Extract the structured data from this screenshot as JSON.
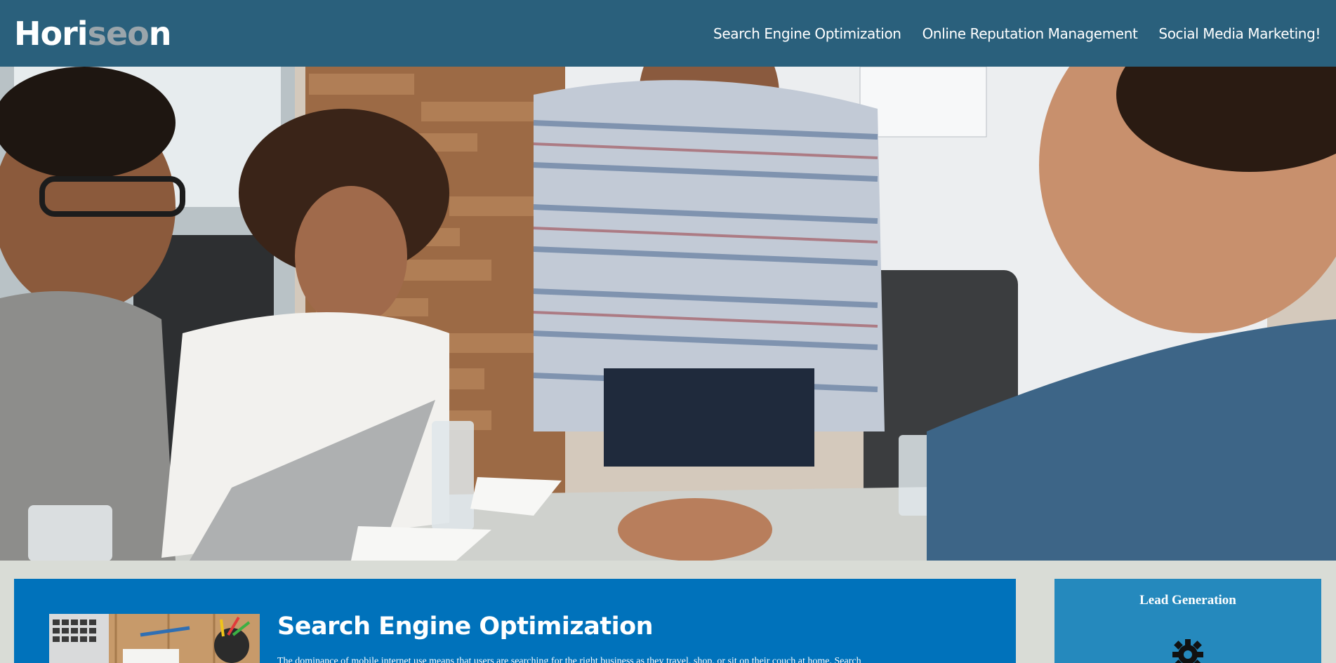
{
  "header": {
    "logo_part1": "Hori",
    "logo_part2": "seo",
    "logo_part3": "n",
    "nav": [
      {
        "label": "Search Engine Optimization"
      },
      {
        "label": "Online Reputation Management"
      },
      {
        "label": "Social Media Marketing!"
      }
    ]
  },
  "hero": {
    "image": "team-meeting-photo"
  },
  "main": {
    "section_title": "Search Engine Optimization",
    "section_text": "The dominance of mobile internet use means that users are searching for the right business as they travel, shop, or sit on their couch at home. Search",
    "section_image": "desk-workspace-image"
  },
  "sidebar": {
    "title": "Lead Generation",
    "icon": "gear-icon"
  },
  "colors": {
    "header_bg": "#2a607c",
    "content_bg": "#0072bb",
    "sidebar_bg": "#2589bd",
    "page_bg": "#d9dcd6",
    "logo_accent": "#9aa5ab"
  }
}
